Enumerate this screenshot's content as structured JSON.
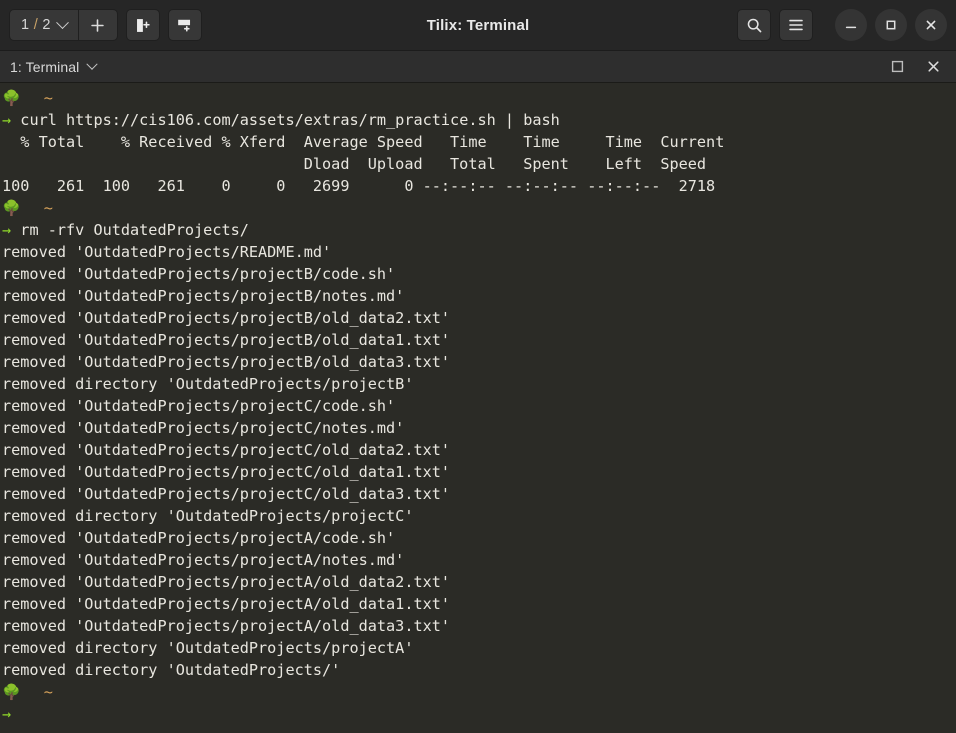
{
  "window": {
    "title": "Tilix: Terminal",
    "session_selector": "1 / 2",
    "session_current": "1",
    "session_total": "2",
    "buttons": {
      "new_session": "+",
      "add_terminal_right": "split-right",
      "add_terminal_down": "split-down",
      "search": "search",
      "menu": "hamburger-menu",
      "minimize": "minimize",
      "maximize": "maximize",
      "close": "close"
    }
  },
  "tab": {
    "label": "1: Terminal",
    "maximize_glyph": "maximize-pane",
    "close_glyph": "close-pane"
  },
  "terminal": {
    "prompt_icon": "🌳",
    "prompt_dir": "~",
    "prompt_arrow": "→",
    "colors": {
      "background": "#2b2b26",
      "foreground": "#e8e6df",
      "arrow_green": "#8fd92a",
      "tilde_orange": "#d5a15a"
    },
    "blocks": [
      {
        "command": "curl https://cis106.com/assets/extras/rm_practice.sh | bash",
        "output": [
          "  % Total    % Received % Xferd  Average Speed   Time    Time     Time  Current",
          "                                 Dload  Upload   Total   Spent    Left  Speed",
          "100   261  100   261    0     0   2699      0 --:--:-- --:--:-- --:--:--  2718"
        ]
      },
      {
        "command": "rm -rfv OutdatedProjects/",
        "output": [
          "removed 'OutdatedProjects/README.md'",
          "removed 'OutdatedProjects/projectB/code.sh'",
          "removed 'OutdatedProjects/projectB/notes.md'",
          "removed 'OutdatedProjects/projectB/old_data2.txt'",
          "removed 'OutdatedProjects/projectB/old_data1.txt'",
          "removed 'OutdatedProjects/projectB/old_data3.txt'",
          "removed directory 'OutdatedProjects/projectB'",
          "removed 'OutdatedProjects/projectC/code.sh'",
          "removed 'OutdatedProjects/projectC/notes.md'",
          "removed 'OutdatedProjects/projectC/old_data2.txt'",
          "removed 'OutdatedProjects/projectC/old_data1.txt'",
          "removed 'OutdatedProjects/projectC/old_data3.txt'",
          "removed directory 'OutdatedProjects/projectC'",
          "removed 'OutdatedProjects/projectA/code.sh'",
          "removed 'OutdatedProjects/projectA/notes.md'",
          "removed 'OutdatedProjects/projectA/old_data2.txt'",
          "removed 'OutdatedProjects/projectA/old_data1.txt'",
          "removed 'OutdatedProjects/projectA/old_data3.txt'",
          "removed directory 'OutdatedProjects/projectA'",
          "removed directory 'OutdatedProjects/'"
        ]
      },
      {
        "command": "",
        "output": []
      }
    ]
  }
}
